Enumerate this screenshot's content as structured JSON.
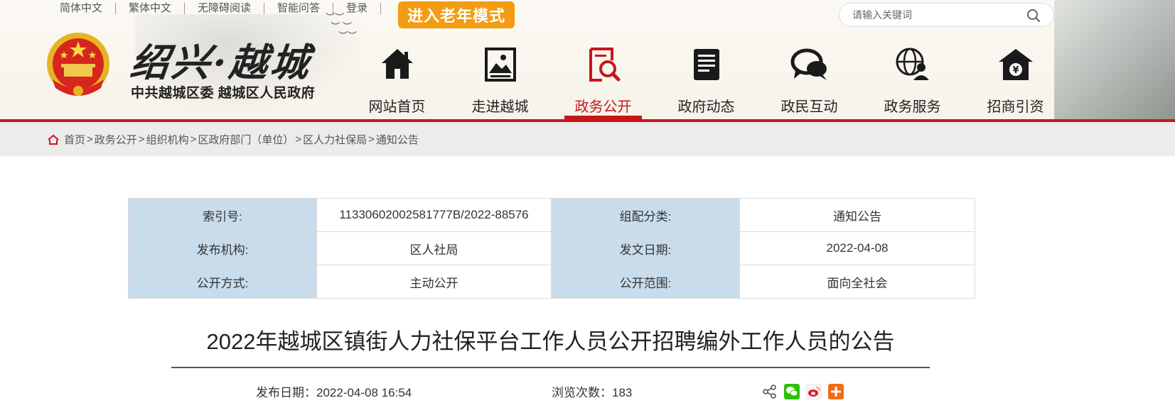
{
  "top_links": [
    "简体中文",
    "繁体中文",
    "无障碍阅读",
    "智能问答",
    "登录"
  ],
  "elder_mode_label": "进入老年模式",
  "search": {
    "placeholder": "请输入关键词"
  },
  "site": {
    "calligraphy": "绍兴·越城",
    "org": "中共越城区委 越城区人民政府"
  },
  "nav": [
    {
      "label": "网站首页",
      "icon": "home-icon"
    },
    {
      "label": "走进越城",
      "icon": "picture-icon"
    },
    {
      "label": "政务公开",
      "icon": "document-search-icon",
      "active": true
    },
    {
      "label": "政府动态",
      "icon": "news-icon"
    },
    {
      "label": "政民互动",
      "icon": "chat-icon"
    },
    {
      "label": "政务服务",
      "icon": "globe-user-icon"
    },
    {
      "label": "招商引资",
      "icon": "yuan-house-icon"
    }
  ],
  "breadcrumb": [
    "首页",
    "政务公开",
    "组织机构",
    "区政府部门（单位）",
    "区人力社保局",
    "通知公告"
  ],
  "meta": [
    {
      "k1": "索引号:",
      "v1": "11330602002581777B/2022-88576",
      "k2": "组配分类:",
      "v2": "通知公告"
    },
    {
      "k1": "发布机构:",
      "v1": "区人社局",
      "k2": "发文日期:",
      "v2": "2022-04-08"
    },
    {
      "k1": "公开方式:",
      "v1": "主动公开",
      "k2": "公开范围:",
      "v2": "面向全社会"
    }
  ],
  "article": {
    "title": "2022年越城区镇街人力社保平台工作人员公开招聘编外工作人员的公告",
    "publish_date": "发布日期：2022-04-08 16:54",
    "views": "浏览次数：183"
  },
  "colors": {
    "accent_red": "#c8161d",
    "elder_orange": "#f39c12",
    "meta_key_bg": "#c9dceb",
    "crumb_bg": "#ececec"
  }
}
